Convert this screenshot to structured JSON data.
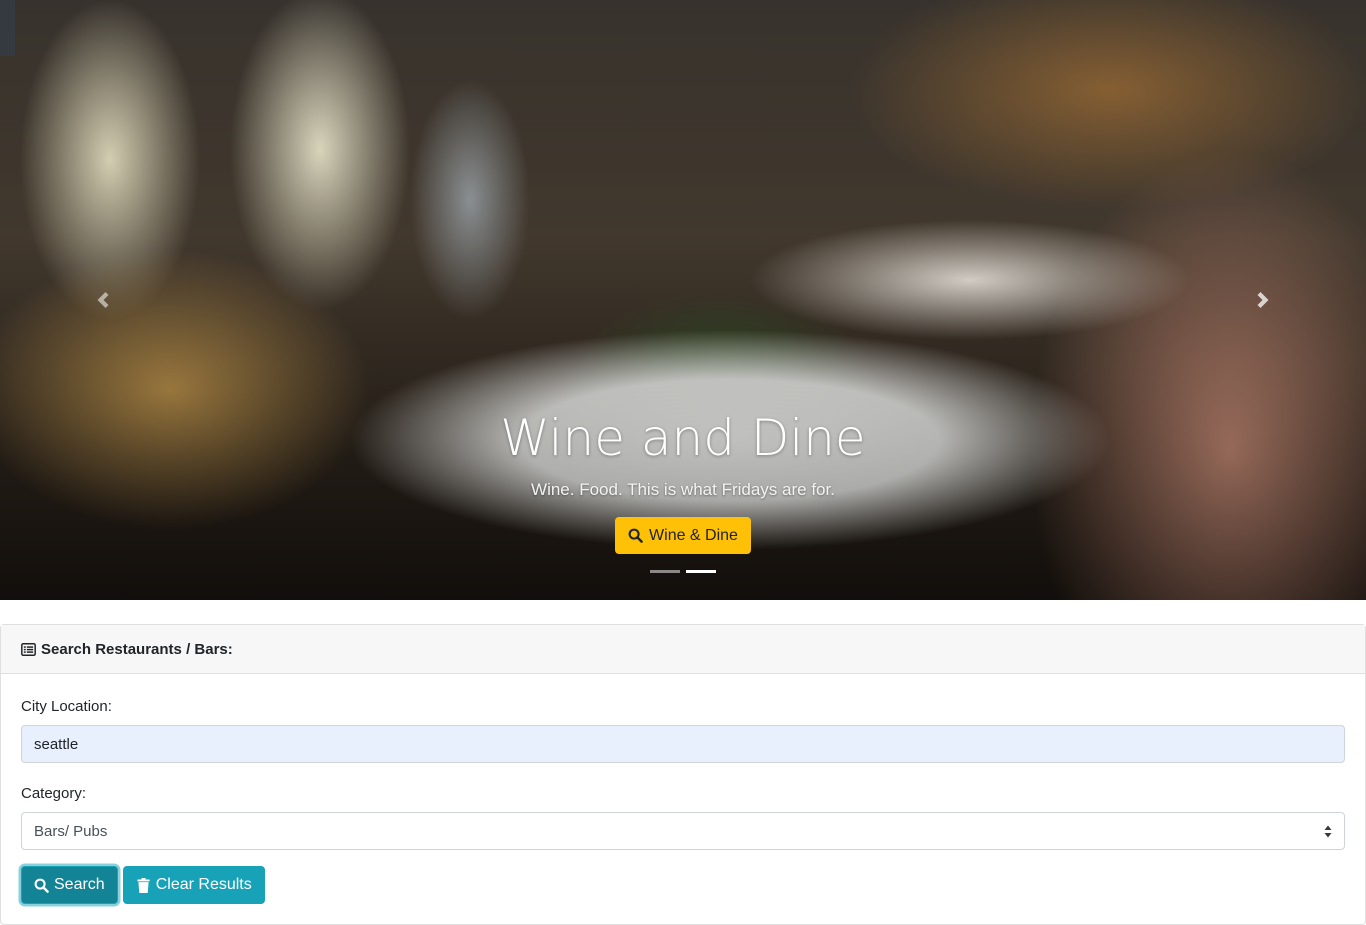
{
  "carousel": {
    "prev_icon": "chevron-left-icon",
    "next_icon": "chevron-right-icon",
    "slide_count": 2,
    "active_slide": 2,
    "caption": {
      "title": "Wine and Dine",
      "subtitle": "Wine. Food. This is what Fridays are for.",
      "button_label": "Wine & Dine",
      "button_icon": "search-icon"
    }
  },
  "search_card": {
    "header_icon": "list-alt-icon",
    "header_title": "Search Restaurants / Bars:",
    "city": {
      "label": "City Location:",
      "value": "seattle"
    },
    "category": {
      "label": "Category:",
      "selected": "Bars/ Pubs"
    },
    "search_button": {
      "label": "Search",
      "icon": "search-icon"
    },
    "clear_button": {
      "label": "Clear Results",
      "icon": "trash-icon"
    }
  },
  "colors": {
    "warning": "#ffc107",
    "info": "#17a2b8",
    "autofill": "#e8f0fe"
  }
}
